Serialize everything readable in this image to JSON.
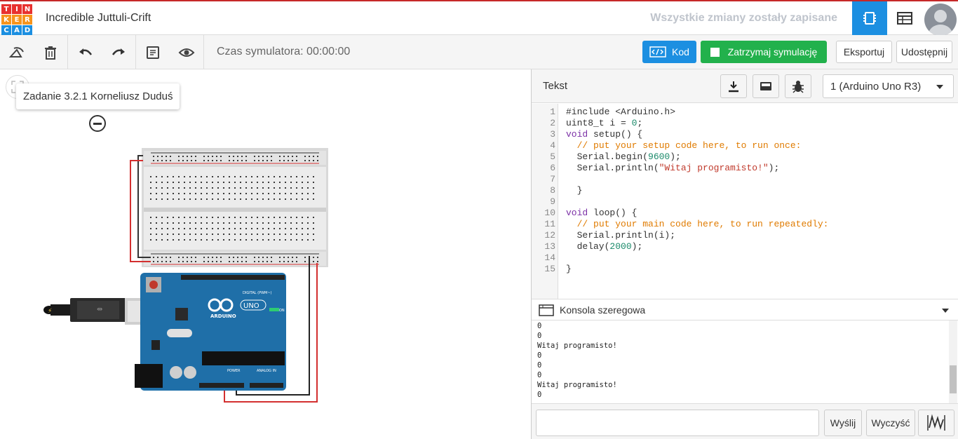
{
  "app": {
    "logo_letters": [
      "T",
      "I",
      "N",
      "K",
      "E",
      "R",
      "C",
      "A",
      "D"
    ],
    "logo_colors": [
      "#e8312f",
      "#e8312f",
      "#e8312f",
      "#f7941d",
      "#f7941d",
      "#f7941d",
      "#1c8fe1",
      "#1c8fe1",
      "#1c8fe1"
    ],
    "project_title": "Incredible Juttuli-Crift",
    "save_status": "Wszystkie zmiany zostały zapisane"
  },
  "toolbar": {
    "sim_time": "Czas symulatora: 00:00:00",
    "code_label": "Kod",
    "stop_label": "Zatrzymaj symulację",
    "export_label": "Eksportuj",
    "share_label": "Udostępnij"
  },
  "canvas": {
    "note_text": "Zadanie 3.2.1 Korneliusz Duduś",
    "arduino_label": "ARDUINO",
    "uno_label": "UNO",
    "digital_label": "DIGITAL (PWM~)",
    "power_label": "POWER",
    "analog_label": "ANALOG IN",
    "on_label": "ON"
  },
  "code_panel": {
    "mode": "Tekst",
    "device": "1 (Arduino Uno R3)",
    "lines": [
      {
        "n": "1",
        "html": "#include &lt;Arduino.h&gt;"
      },
      {
        "n": "2",
        "html": "uint8_t i = <span class='num'>0</span>;"
      },
      {
        "n": "3",
        "html": "<span class='kw'>void</span> setup() {"
      },
      {
        "n": "4",
        "html": "  <span class='cm'>// put your setup code here, to run once:</span>"
      },
      {
        "n": "5",
        "html": "  Serial.begin(<span class='num'>9600</span>);"
      },
      {
        "n": "6",
        "html": "  Serial.println(<span class='str'>\"Witaj programisto!\"</span>);"
      },
      {
        "n": "7",
        "html": ""
      },
      {
        "n": "8",
        "html": "  }"
      },
      {
        "n": "9",
        "html": ""
      },
      {
        "n": "10",
        "html": "<span class='kw'>void</span> loop() {"
      },
      {
        "n": "11",
        "html": "  <span class='cm'>// put your main code here, to run repeatedly:</span>"
      },
      {
        "n": "12",
        "html": "  Serial.println(i);"
      },
      {
        "n": "13",
        "html": "  delay(<span class='num'>2000</span>);"
      },
      {
        "n": "14",
        "html": ""
      },
      {
        "n": "15",
        "html": "}"
      }
    ]
  },
  "console": {
    "title": "Konsola szeregowa",
    "output": [
      "0",
      "0",
      "Witaj programisto!",
      "0",
      "0",
      "0",
      "Witaj programisto!",
      "0"
    ],
    "send_label": "Wyślij",
    "clear_label": "Wyczyść"
  },
  "colors": {
    "accent_blue": "#1c8fe1",
    "sim_green": "#22b14c",
    "arduino_blue": "#1f6fa8"
  }
}
